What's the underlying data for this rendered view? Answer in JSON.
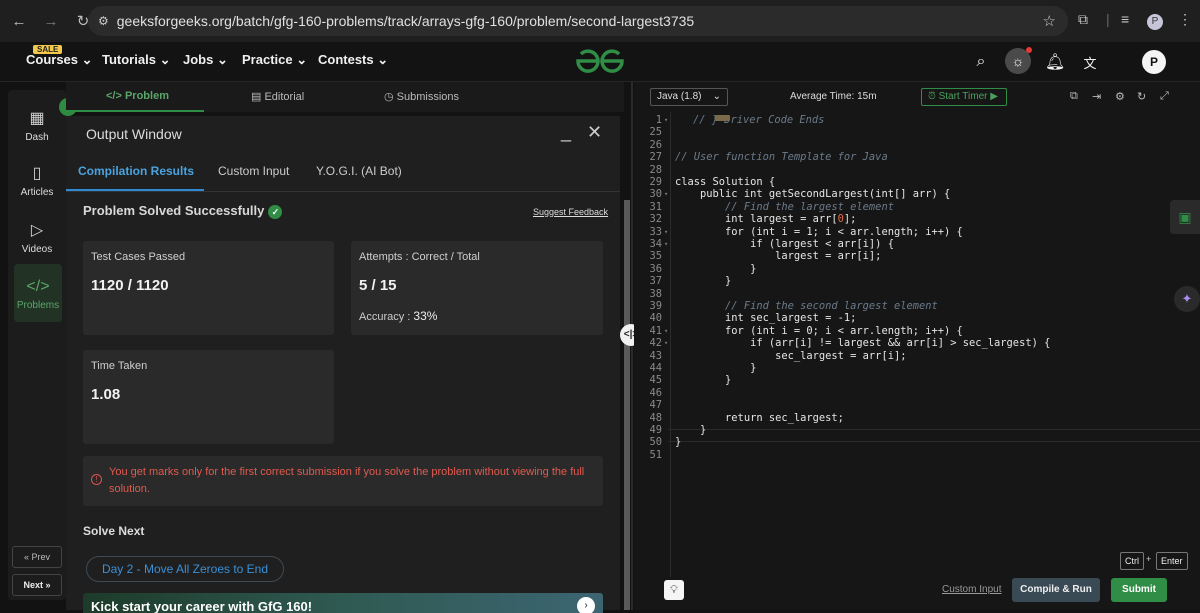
{
  "browser": {
    "url": "geeksforgeeks.org/batch/gfg-160-problems/track/arrays-gfg-160/problem/second-largest3735",
    "profile_initial": "P"
  },
  "site_nav": {
    "sale_badge": "SALE",
    "menus": [
      "Courses",
      "Tutorials",
      "Jobs",
      "Practice",
      "Contests"
    ],
    "avatar_initial": "P"
  },
  "sidebar": {
    "items": [
      {
        "label": "Dash",
        "icon": "dashboard-icon"
      },
      {
        "label": "Articles",
        "icon": "book-icon"
      },
      {
        "label": "Videos",
        "icon": "video-icon"
      },
      {
        "label": "Problems",
        "icon": "code-icon"
      }
    ],
    "prev_label": "« Prev",
    "next_label": "Next »"
  },
  "problem_tabs": {
    "problem": "</> Problem",
    "editorial": "Editorial",
    "submissions": "Submissions"
  },
  "output_window": {
    "title": "Output Window",
    "tabs": [
      "Compilation Results",
      "Custom Input",
      "Y.O.G.I. (AI Bot)"
    ],
    "status": "Problem Solved Successfully",
    "suggest_feedback": "Suggest Feedback",
    "test_cases_label": "Test Cases Passed",
    "test_cases_value": "1120 / 1120",
    "attempts_label": "Attempts : Correct / Total",
    "attempts_value": "5 / 15",
    "accuracy_label": "Accuracy :",
    "accuracy_value": "33%",
    "time_label": "Time Taken",
    "time_value": "1.08",
    "warning": "You get marks only for the first correct submission if you solve the problem without viewing the full solution.",
    "solve_next": "Solve Next",
    "next_problem": "Day 2 - Move All Zeroes to End",
    "promo": "Kick start your career with GfG 160!"
  },
  "editor": {
    "language": "Java (1.8)",
    "avg_time": "Average Time: 15m",
    "start_timer": "Start Timer",
    "custom_input": "Custom Input",
    "compile_run": "Compile & Run",
    "submit": "Submit",
    "shortcut_ctrl": "Ctrl",
    "shortcut_plus": "+",
    "shortcut_enter": "Enter",
    "line_numbers": [
      "1",
      "25",
      "26",
      "27",
      "28",
      "29",
      "30",
      "31",
      "32",
      "33",
      "34",
      "35",
      "36",
      "37",
      "38",
      "39",
      "40",
      "41",
      "42",
      "43",
      "44",
      "45",
      "46",
      "47",
      "48",
      "49",
      "50",
      "51"
    ],
    "code_lines": [
      "// } Driver Code Ends",
      "",
      "",
      "// User function Template for Java",
      "",
      "class Solution {",
      "    public int getSecondLargest(int[] arr) {",
      "        // Find the largest element",
      "        int largest = arr[0];",
      "        for (int i = 1; i < arr.length; i++) {",
      "            if (largest < arr[i]) {",
      "                largest = arr[i];",
      "            }",
      "        }",
      "",
      "        // Find the second largest element",
      "        int sec_largest = -1;",
      "        for (int i = 0; i < arr.length; i++) {",
      "            if (arr[i] != largest && arr[i] > sec_largest) {",
      "                sec_largest = arr[i];",
      "            }",
      "        }",
      "",
      "        ",
      "        return sec_largest;",
      "    }",
      "}",
      ""
    ]
  }
}
